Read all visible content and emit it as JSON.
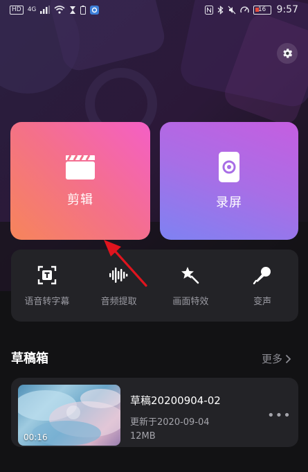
{
  "status_bar": {
    "hd": "HD",
    "net": "4G",
    "battery": "16",
    "time": "9:57"
  },
  "icons": {
    "settings": "gear-icon",
    "edit": "clapperboard-icon",
    "record": "phone-record-icon",
    "more_chevron": "chevron-right-icon",
    "draft_menu": "more-dots-icon"
  },
  "main_cards": [
    {
      "label": "剪辑"
    },
    {
      "label": "录屏"
    }
  ],
  "tools": [
    {
      "label": "语音转字幕",
      "icon": "speech-to-text-icon"
    },
    {
      "label": "音频提取",
      "icon": "waveform-icon"
    },
    {
      "label": "画面特效",
      "icon": "magic-wand-icon"
    },
    {
      "label": "变声",
      "icon": "microphone-icon"
    }
  ],
  "drafts": {
    "title": "草稿箱",
    "more": "更多",
    "items": [
      {
        "name": "草稿20200904-02",
        "updated": "更新于2020-09-04",
        "size": "12MB",
        "duration": "00:16",
        "menu": "•••"
      }
    ]
  },
  "colors": {
    "background": "#121214",
    "panel": "#232327",
    "edit_card": "#f46a9a",
    "record_card": "#a86ee6",
    "annotation_arrow": "#e0141e"
  }
}
